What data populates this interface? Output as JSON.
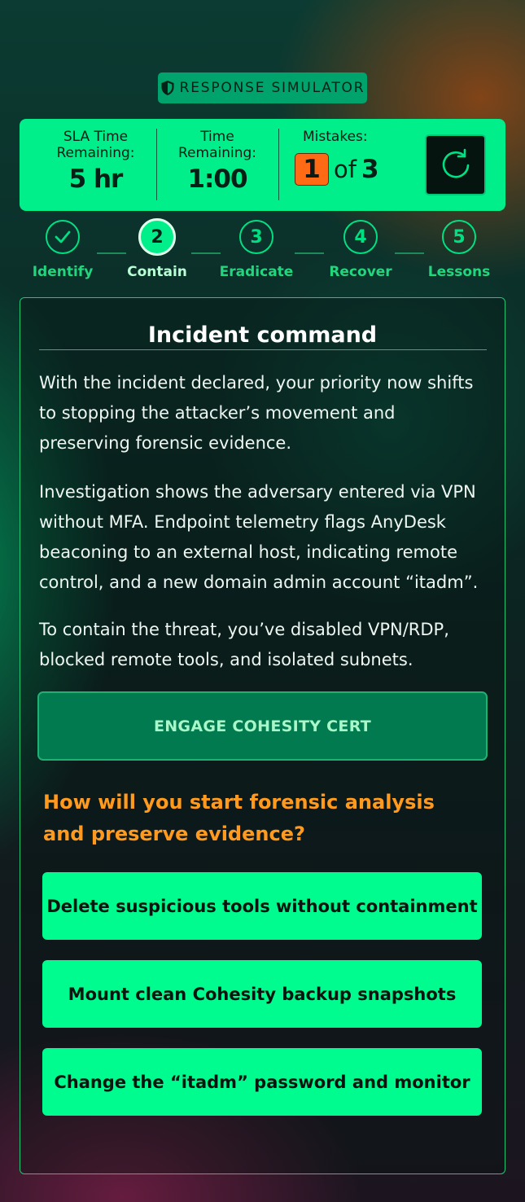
{
  "badge": {
    "label": "RESPONSE SIMULATOR",
    "icon": "shield-icon"
  },
  "stats": {
    "sla_label_line1": "SLA Time",
    "sla_label_line2": "Remaining:",
    "sla_value": "5 hr",
    "time_label_line1": "Time",
    "time_label_line2": "Remaining:",
    "time_value": "1:00",
    "mistakes_label": "Mistakes:",
    "mistakes_count": "1",
    "mistakes_of": "of",
    "mistakes_total": "3",
    "refresh_icon": "refresh-icon"
  },
  "steps": [
    {
      "number": "",
      "label": "Identify",
      "state": "complete"
    },
    {
      "number": "2",
      "label": "Contain",
      "state": "active"
    },
    {
      "number": "3",
      "label": "Eradicate",
      "state": "upcoming"
    },
    {
      "number": "4",
      "label": "Recover",
      "state": "upcoming"
    },
    {
      "number": "5",
      "label": "Lessons",
      "state": "upcoming"
    }
  ],
  "card": {
    "title": "Incident command",
    "paragraphs": [
      "With the incident declared, your priority now shifts to stopping the attacker’s movement and preserving forensic evidence.",
      "Investigation shows the adversary entered via VPN without MFA. Endpoint telemetry flags AnyDesk beaconing to an external host, indicating remote control, and a new domain admin account “itadm”.",
      "To contain the threat, you’ve disabled VPN/RDP, blocked remote tools, and isolated subnets."
    ],
    "cert_button": "ENGAGE COHESITY CERT",
    "question": "How will you start forensic analysis and preserve evidence?",
    "choices": [
      "Delete suspicious tools without containment",
      "Mount clean Cohesity backup snapshots",
      "Change the “itadm” password and monitor"
    ]
  },
  "colors": {
    "accent": "#00ef8a",
    "mistake": "#ff6a14",
    "question": "#ff9a1f"
  }
}
